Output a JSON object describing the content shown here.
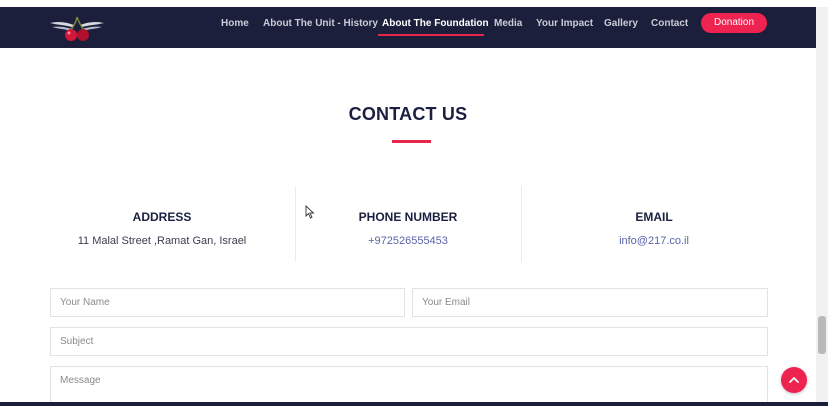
{
  "nav": {
    "logo_icon": "cherry-wings-logo",
    "links": [
      {
        "label": "Home"
      },
      {
        "label": "About The Unit - History"
      },
      {
        "label": "About The Foundation"
      },
      {
        "label": "Media"
      },
      {
        "label": "Your Impact"
      },
      {
        "label": "Gallery"
      },
      {
        "label": "Contact"
      }
    ],
    "active_link": "About The Foundation",
    "donate_label": "Donation"
  },
  "contact": {
    "title": "CONTACT US",
    "address": {
      "heading": "ADDRESS",
      "value": "11 Malal Street ,Ramat Gan, Israel"
    },
    "phone": {
      "heading": "PHONE NUMBER",
      "value": "+972526555453"
    },
    "email": {
      "heading": "EMAIL",
      "value": "info@217.co.il"
    }
  },
  "form": {
    "name_placeholder": "Your Name",
    "email_placeholder": "Your Email",
    "subject_placeholder": "Subject",
    "message_placeholder": "Message"
  },
  "colors": {
    "navbar_bg": "#1b1f3b",
    "accent": "#ee2350",
    "heading": "#1b2040",
    "link": "#5a64a8"
  },
  "icons": {
    "back_to_top": "chevron-up-icon",
    "cursor": "mouse-pointer-icon"
  }
}
